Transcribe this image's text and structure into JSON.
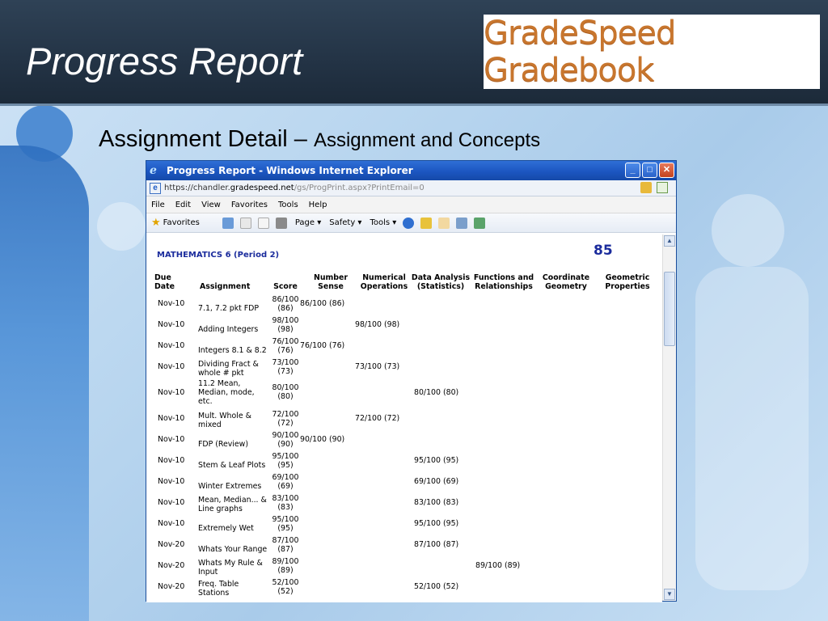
{
  "slide": {
    "title": "Progress Report",
    "logo_text": "GradeSpeed Gradebook",
    "subtitle_main": "Assignment Detail – ",
    "subtitle_sub": "Assignment and Concepts"
  },
  "browser": {
    "window_title": "Progress Report - Windows Internet Explorer",
    "url_prefix": "https://chandler.",
    "url_domain": "gradespeed.net",
    "url_path": "/gs/ProgPrint.aspx?PrintEmail=0",
    "menu": [
      "File",
      "Edit",
      "View",
      "Favorites",
      "Tools",
      "Help"
    ],
    "favorites_label": "Favorites",
    "toolbar": [
      "Page ▾",
      "Safety ▾",
      "Tools ▾"
    ]
  },
  "report": {
    "course": "MATHEMATICS 6 (Period 2)",
    "average": "85",
    "headers": [
      "Due\nDate",
      "Assignment",
      "Score",
      "Number\nSense",
      "Numerical\nOperations",
      "Data Analysis\n(Statistics)",
      "Functions and\nRelationships",
      "Coordinate\nGeometry",
      "Geometric\nProperties"
    ],
    "rows": [
      {
        "date": "Nov-10",
        "assignment": "7.1, 7.2 pkt FDP",
        "score": "86/100\n(86)",
        "col": 3,
        "concept": "86/100 (86)"
      },
      {
        "date": "Nov-10",
        "assignment": "Adding Integers",
        "score": "98/100\n(98)",
        "col": 4,
        "concept": "98/100 (98)"
      },
      {
        "date": "Nov-10",
        "assignment": "Integers 8.1 & 8.2",
        "score": "76/100\n(76)",
        "col": 3,
        "concept": "76/100 (76)"
      },
      {
        "date": "Nov-10",
        "assignment": "Dividing Fract &\nwhole # pkt",
        "score": "73/100\n(73)",
        "col": 4,
        "concept": "73/100 (73)"
      },
      {
        "date": "Nov-10",
        "assignment": "11.2 Mean,\nMedian, mode,\netc.",
        "score": "80/100\n(80)",
        "col": 5,
        "concept": "80/100 (80)"
      },
      {
        "date": "Nov-10",
        "assignment": "Mult. Whole &\nmixed",
        "score": "72/100\n(72)",
        "col": 4,
        "concept": "72/100 (72)"
      },
      {
        "date": "Nov-10",
        "assignment": "FDP (Review)",
        "score": "90/100\n(90)",
        "col": 3,
        "concept": "90/100 (90)"
      },
      {
        "date": "Nov-10",
        "assignment": "Stem & Leaf Plots",
        "score": "95/100\n(95)",
        "col": 5,
        "concept": "95/100 (95)"
      },
      {
        "date": "Nov-10",
        "assignment": "Winter Extremes",
        "score": "69/100\n(69)",
        "col": 5,
        "concept": "69/100 (69)"
      },
      {
        "date": "Nov-10",
        "assignment": "Mean, Median... &\nLine graphs",
        "score": "83/100\n(83)",
        "col": 5,
        "concept": "83/100 (83)"
      },
      {
        "date": "Nov-10",
        "assignment": "Extremely Wet",
        "score": "95/100\n(95)",
        "col": 5,
        "concept": "95/100 (95)"
      },
      {
        "date": "Nov-20",
        "assignment": "Whats Your Range",
        "score": "87/100\n(87)",
        "col": 5,
        "concept": "87/100 (87)"
      },
      {
        "date": "Nov-20",
        "assignment": "Whats My Rule &\nInput",
        "score": "89/100\n(89)",
        "col": 6,
        "concept": "89/100 (89)"
      },
      {
        "date": "Nov-20",
        "assignment": "Freq. Table\nStations",
        "score": "52/100\n(52)",
        "col": 5,
        "concept": "52/100 (52)"
      }
    ]
  }
}
